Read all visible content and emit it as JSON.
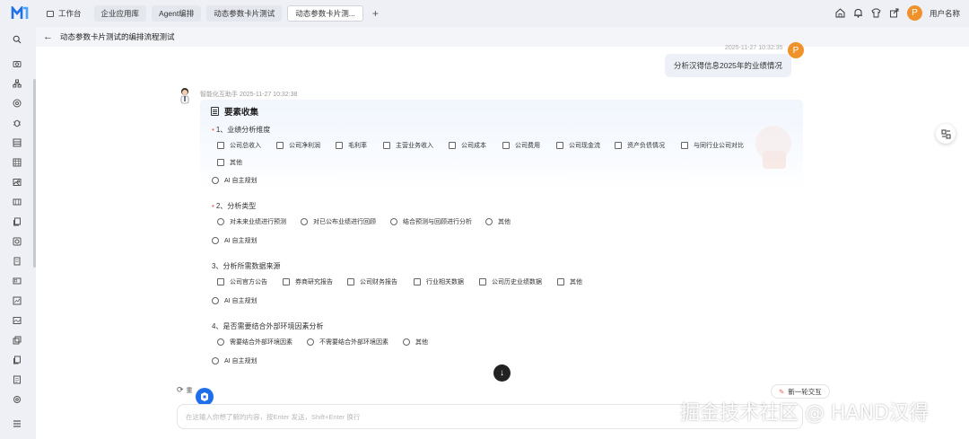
{
  "tabs": [
    {
      "label": "工作台",
      "active": false
    },
    {
      "label": "企业应用库",
      "active": false
    },
    {
      "label": "Agent编排",
      "active": false
    },
    {
      "label": "动态参数卡片测试",
      "active": false
    },
    {
      "label": "动态参数卡片测...",
      "active": true
    }
  ],
  "topbar": {
    "username": "用户名称",
    "avatar_letter": "P"
  },
  "header": {
    "title": "动态参数卡片测试的编排流程测试"
  },
  "user_message": {
    "time": "2025-11-27 10:32:35",
    "text": "分析汉得信息2025年的业绩情况",
    "avatar_letter": "P"
  },
  "bot": {
    "name_time": "智能化互助手 2025-11-27 10:32:38"
  },
  "card": {
    "title": "要素收集"
  },
  "questions": [
    {
      "title": "1、业绩分析维度",
      "required": true,
      "type": "checkbox",
      "options": [
        "公司总收入",
        "公司净利润",
        "毛利率",
        "主营业务收入",
        "公司成本",
        "公司费用",
        "公司现金流",
        "资产负债情况",
        "与同行业公司对比",
        "其他"
      ],
      "ai_option": "AI 自主规划"
    },
    {
      "title": "2、分析类型",
      "required": true,
      "type": "radio",
      "options": [
        "对未来业绩进行预测",
        "对已公布业绩进行回顾",
        "结合预测与回顾进行分析",
        "其他"
      ],
      "ai_option": "AI 自主规划"
    },
    {
      "title": "3、分析所需数据来源",
      "required": false,
      "type": "checkbox",
      "options": [
        "公司官方公告",
        "券商研究报告",
        "公司财务报告",
        "行业相关数据",
        "公司历史业绩数据",
        "其他"
      ],
      "ai_option": "AI 自主规划"
    },
    {
      "title": "4、是否需要结合外部环境因素分析",
      "required": false,
      "type": "radio",
      "options": [
        "需要结合外部环境因素",
        "不需要结合外部环境因素",
        "其他"
      ],
      "ai_option": "AI 自主规划"
    }
  ],
  "footer": {
    "refresh_label": "重",
    "new_round_label": "新一轮交互",
    "input_placeholder": "在这输入你想了解的内容，按Enter 发送，Shift+Enter 换行"
  },
  "watermark": "掘金技术社区 @ HAND汉得",
  "colors": {
    "accent": "#f0922b",
    "badge": "#1f6feb",
    "required": "#e36b5a"
  }
}
